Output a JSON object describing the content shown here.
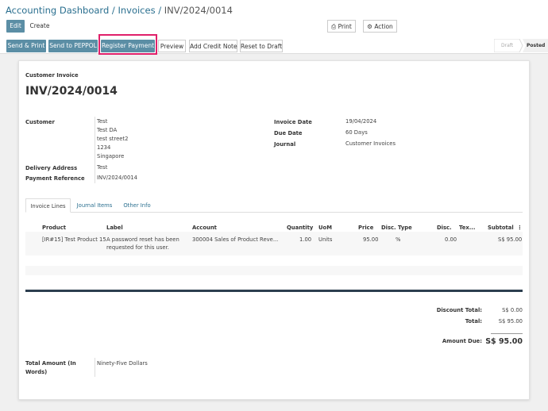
{
  "breadcrumb": {
    "part1": "Accounting Dashboard",
    "sep1": " / ",
    "part2": "Invoices",
    "sep2": " / ",
    "current": "INV/2024/0014"
  },
  "toolbar": {
    "edit": "Edit",
    "create": "Create",
    "print": "Print",
    "action": "Action",
    "print_icon": "printer-icon",
    "action_icon": "gear-icon"
  },
  "actions": {
    "send_print": "Send & Print",
    "send_peppol": "Send to PEPPOL",
    "register_payment": "Register Payment",
    "preview": "Preview",
    "add_credit_note": "Add Credit Note",
    "reset_to_draft": "Reset to Draft"
  },
  "status": {
    "draft": "Draft",
    "posted": "Posted"
  },
  "invoice": {
    "type_label": "Customer Invoice",
    "number": "INV/2024/0014",
    "customer_label": "Customer",
    "customer_name": "Test",
    "customer_addr1": "Test DA",
    "customer_addr2": "test street2",
    "customer_addr3": "1234",
    "customer_addr4": "Singapore",
    "delivery_label": "Delivery Address",
    "delivery_value": "Test",
    "payment_ref_label": "Payment Reference",
    "payment_ref_value": "INV/2024/0014",
    "invoice_date_label": "Invoice Date",
    "invoice_date_value": "19/04/2024",
    "due_date_label": "Due Date",
    "due_date_value": "60 Days",
    "journal_label": "Journal",
    "journal_value": "Customer Invoices"
  },
  "tabs": {
    "invoice_lines": "Invoice Lines",
    "journal_items": "Journal Items",
    "other_info": "Other Info"
  },
  "table": {
    "headers": {
      "product": "Product",
      "label": "Label",
      "account": "Account",
      "quantity": "Quantity",
      "uom": "UoM",
      "price": "Price",
      "disc_type": "Disc. Type",
      "disc": "Disc.",
      "taxes": "Tex...",
      "subtotal": "Subtotal",
      "menu": "⋮"
    },
    "row": {
      "product": "[IR#15] Test Product 15",
      "label_l1": "A password reset has been",
      "label_l2": "requested for this user.",
      "account": "300004 Sales of Product Reve...",
      "quantity": "1.00",
      "uom": "Units",
      "price": "95.00",
      "disc_type": "%",
      "disc": "0.00",
      "taxes": "",
      "subtotal": "S$ 95.00"
    }
  },
  "totals": {
    "discount_label": "Discount Total:",
    "discount_value": "S$ 0.00",
    "total_label": "Total:",
    "total_value": "S$ 95.00",
    "amount_due_label": "Amount Due:",
    "amount_due_value": "S$ 95.00"
  },
  "words": {
    "label_l1": "Total Amount (In",
    "label_l2": "Words)",
    "value": "Ninety-Five Dollars"
  }
}
